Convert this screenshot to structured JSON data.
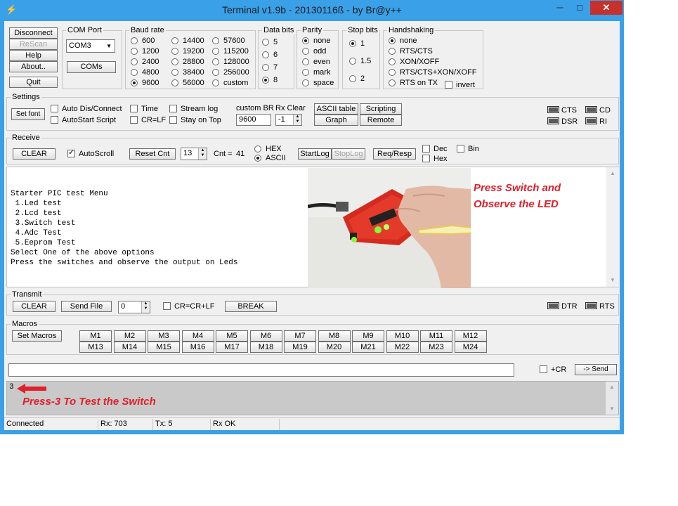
{
  "window": {
    "title": "Terminal v1.9b - 20130116ß - by Br@y++",
    "minimize_glyph": "─",
    "maximize_glyph": "□",
    "close_glyph": "✕",
    "app_icon": "plug-icon"
  },
  "left_buttons": {
    "disconnect": "Disconnect",
    "rescan": "ReScan",
    "help": "Help",
    "about": "About..",
    "quit": "Quit"
  },
  "com_port": {
    "label": "COM Port",
    "value": "COM3",
    "coms_button": "COMs"
  },
  "baud_rate": {
    "label": "Baud rate",
    "col1": [
      "600",
      "1200",
      "2400",
      "4800",
      "9600"
    ],
    "col2": [
      "14400",
      "19200",
      "28800",
      "38400",
      "56000"
    ],
    "col3": [
      "57600",
      "115200",
      "128000",
      "256000",
      "custom"
    ],
    "selected": "9600"
  },
  "data_bits": {
    "label": "Data bits",
    "options": [
      "5",
      "6",
      "7",
      "8"
    ],
    "selected": "8"
  },
  "parity": {
    "label": "Parity",
    "options": [
      "none",
      "odd",
      "even",
      "mark",
      "space"
    ],
    "selected": "none"
  },
  "stop_bits": {
    "label": "Stop bits",
    "options": [
      "1",
      "1.5",
      "2"
    ],
    "selected": "1"
  },
  "handshaking": {
    "label": "Handshaking",
    "options": [
      "none",
      "RTS/CTS",
      "XON/XOFF",
      "RTS/CTS+XON/XOFF",
      "RTS on TX"
    ],
    "selected": "none",
    "invert_label": "invert"
  },
  "settings": {
    "label": "Settings",
    "set_font": "Set font",
    "auto_dis_connect": "Auto Dis/Connect",
    "autostart_script": "AutoStart Script",
    "time": "Time",
    "cr_lf": "CR=LF",
    "stream_log": "Stream log",
    "stay_on_top": "Stay on Top",
    "custom_br_label": "custom BR",
    "custom_br_value": "9600",
    "rx_clear_label": "Rx Clear",
    "rx_clear_value": "-1",
    "ascii_table": "ASCII table",
    "graph": "Graph",
    "scripting": "Scripting",
    "remote": "Remote",
    "leds": [
      "CTS",
      "CD",
      "DSR",
      "RI"
    ]
  },
  "receive": {
    "label": "Receive",
    "clear": "CLEAR",
    "autoscroll": "AutoScroll",
    "reset_cnt": "Reset Cnt",
    "cnt_spin": "13",
    "cnt_label": "Cnt =",
    "cnt_value": "41",
    "hex": "HEX",
    "ascii": "ASCII",
    "start_log": "StartLog",
    "stop_log": "StopLog",
    "req_resp": "Req/Resp",
    "dec": "Dec",
    "hex2": "Hex",
    "bin": "Bin"
  },
  "terminal_lines": [
    "Starter PIC test Menu",
    " 1.Led test",
    " 2.Lcd test",
    " 3.Switch test",
    " 4.Adc Test",
    " 5.Eeprom Test",
    "Select One of the above options",
    "Press the switches and observe the output on Leds"
  ],
  "annotation_photo": {
    "line1": "Press Switch and",
    "line2": "Observe the LED"
  },
  "transmit": {
    "label": "Transmit",
    "clear": "CLEAR",
    "send_file": "Send File",
    "spin_value": "0",
    "cr_crlf": "CR=CR+LF",
    "break": "BREAK",
    "leds": [
      "DTR",
      "RTS"
    ]
  },
  "macros": {
    "label": "Macros",
    "set_macros": "Set Macros",
    "row1": [
      "M1",
      "M2",
      "M3",
      "M4",
      "M5",
      "M6",
      "M7",
      "M8",
      "M9",
      "M10",
      "M11",
      "M12"
    ],
    "row2": [
      "M13",
      "M14",
      "M15",
      "M16",
      "M17",
      "M18",
      "M19",
      "M20",
      "M21",
      "M22",
      "M23",
      "M24"
    ]
  },
  "send_bar": {
    "input_value": "",
    "plus_cr": "+CR",
    "send": "-> Send"
  },
  "transmit_log": {
    "text": "3",
    "annotation": "Press-3 To Test the Switch"
  },
  "status": {
    "connection": "Connected",
    "rx": "Rx: 703",
    "tx": "Tx: 5",
    "rx_status": "Rx OK"
  }
}
